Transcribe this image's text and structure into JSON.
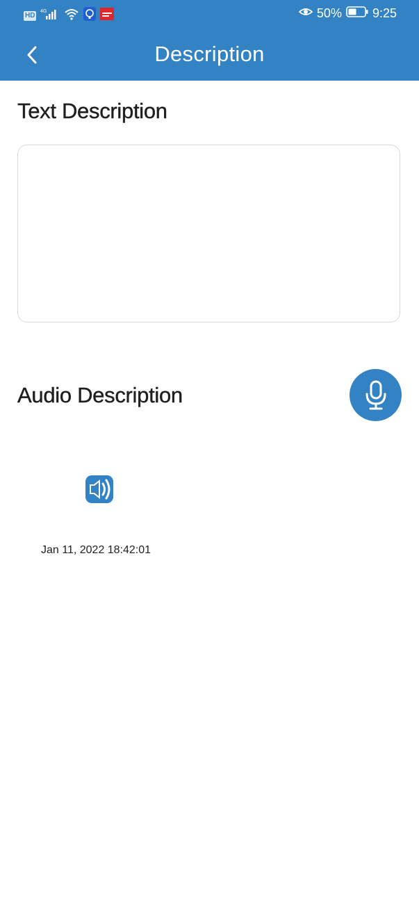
{
  "status_bar": {
    "left_badge": "HD",
    "network": "4G",
    "battery": "50%",
    "time": "9:25",
    "icons": [
      "hd-icon",
      "signal-icon",
      "wifi-icon",
      "app-notification-icon",
      "app-notification-icon",
      "eye-icon",
      "battery-icon"
    ]
  },
  "app_bar": {
    "title": "Description",
    "back_icon": "chevron-left-icon"
  },
  "text_section": {
    "title": "Text Description",
    "value": ""
  },
  "audio_section": {
    "title": "Audio Description",
    "record_icon": "microphone-icon",
    "recordings": [
      {
        "icon": "speaker-icon",
        "date": "Jan 11, 2022 18:42:01"
      }
    ]
  },
  "colors": {
    "primary": "#3282c4",
    "border": "#d8d8d8",
    "background": "#ffffff"
  }
}
